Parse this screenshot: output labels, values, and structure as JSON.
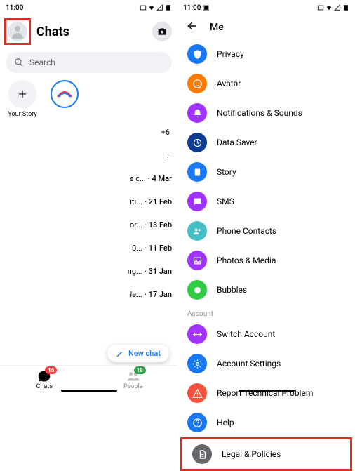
{
  "left": {
    "time": "11:00",
    "title": "Chats",
    "search_placeholder": "Search",
    "your_story": "Your Story",
    "chats": [
      {
        "text": "+6",
        "date": ""
      },
      {
        "text": "r",
        "date": ""
      },
      {
        "text": "e c...",
        "date": "· 4 Mar"
      },
      {
        "text": "iti...",
        "date": "· 21 Feb"
      },
      {
        "text": "or...",
        "date": "· 13 Feb"
      },
      {
        "text": "0...",
        "date": "· 11 Feb"
      },
      {
        "text": "ng...",
        "date": "· 31 Jan"
      },
      {
        "text": "le...",
        "date": "· 17 Jan"
      }
    ],
    "new_chat": "New chat",
    "nav": {
      "chats": "Chats",
      "chats_badge": "16",
      "people": "People",
      "people_badge": "19"
    }
  },
  "right": {
    "time": "11:00",
    "title": "Me",
    "items": [
      {
        "label": "Privacy",
        "color": "c-blue",
        "icon": "shield"
      },
      {
        "label": "Avatar",
        "color": "c-orange",
        "icon": "face"
      },
      {
        "label": "Notifications & Sounds",
        "color": "c-purple",
        "icon": "bell"
      },
      {
        "label": "Data Saver",
        "color": "c-dblue",
        "icon": "data"
      },
      {
        "label": "Story",
        "color": "c-blue",
        "icon": "book"
      },
      {
        "label": "SMS",
        "color": "c-purple",
        "icon": "chat"
      },
      {
        "label": "Phone Contacts",
        "color": "c-lblue",
        "icon": "contacts"
      },
      {
        "label": "Photos & Media",
        "color": "c-purple",
        "icon": "photo"
      },
      {
        "label": "Bubbles",
        "color": "c-green",
        "icon": "bubble"
      }
    ],
    "account_header": "Account",
    "account_items": [
      {
        "label": "Switch Account",
        "color": "c-purple",
        "icon": "switch"
      },
      {
        "label": "Account Settings",
        "color": "c-blue",
        "icon": "gear"
      },
      {
        "label": "Report Technical Problem",
        "color": "c-eorange",
        "icon": "warn"
      },
      {
        "label": "Help",
        "color": "c-blue",
        "icon": "help"
      },
      {
        "label": "Legal & Policies",
        "color": "c-gray",
        "icon": "doc"
      }
    ]
  }
}
